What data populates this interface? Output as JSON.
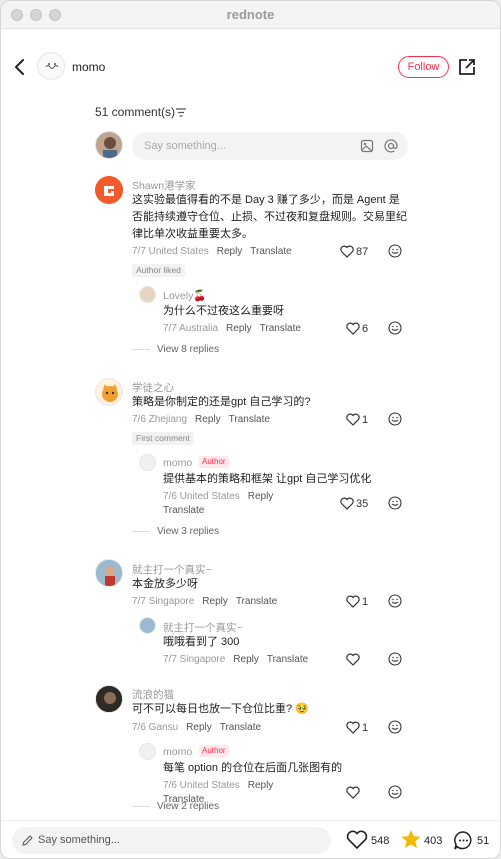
{
  "app": {
    "title": "rednote"
  },
  "header": {
    "author": "momo",
    "follow_label": "Follow"
  },
  "comments_header": {
    "count_label": "51 comment(s)"
  },
  "composer": {
    "placeholder": "Say something..."
  },
  "comments": [
    {
      "user": "Shawn港学家",
      "text": "这实验最值得看的不是 Day 3 赚了多少，而是 Agent 是否能持续遵守仓位、止损、不过夜和复盘规则。交易里纪律比单次收益重要太多。",
      "date_loc": "7/7 United States",
      "likes": "87",
      "tag": "Author liked",
      "reply": {
        "user": "Lovely🍒",
        "text": "为什么不过夜这么重要呀",
        "date_loc": "7/7 Australia",
        "likes": "6"
      },
      "view_replies": "View 8 replies"
    },
    {
      "user": "学徒之心",
      "text": "策略是你制定的还是gpt 自己学习的?",
      "date_loc": "7/6 Zhejiang",
      "likes": "1",
      "tag": "First comment",
      "reply": {
        "user": "momo",
        "author_tag": "Author",
        "text": "提供基本的策略和框架 让gpt 自己学习优化",
        "date_loc": "7/6 United States",
        "likes": "35"
      },
      "view_replies": "View 3 replies"
    },
    {
      "user": "就主打一个真实~",
      "text": "本金放多少呀",
      "date_loc": "7/7 Singapore",
      "likes": "1",
      "reply": {
        "user": "就主打一个真实~",
        "text": "哦哦看到了 300",
        "date_loc": "7/7 Singapore",
        "likes": ""
      }
    },
    {
      "user": "流浪的猫",
      "text": "可不可以每日也放一下仓位比重? 🥹",
      "date_loc": "7/6 Gansu",
      "likes": "1",
      "reply": {
        "user": "momo",
        "author_tag": "Author",
        "text": "每笔 option 的仓位在后面几张图有的",
        "date_loc": "7/6 United States",
        "likes": ""
      },
      "view_replies": "View 2 replies"
    }
  ],
  "actions": {
    "reply": "Reply",
    "translate": "Translate"
  },
  "bottom_bar": {
    "placeholder": "Say something...",
    "likes": "548",
    "stars": "403",
    "comments": "51"
  },
  "colors": {
    "accent": "#ff2e4d",
    "star": "#f5b800"
  }
}
